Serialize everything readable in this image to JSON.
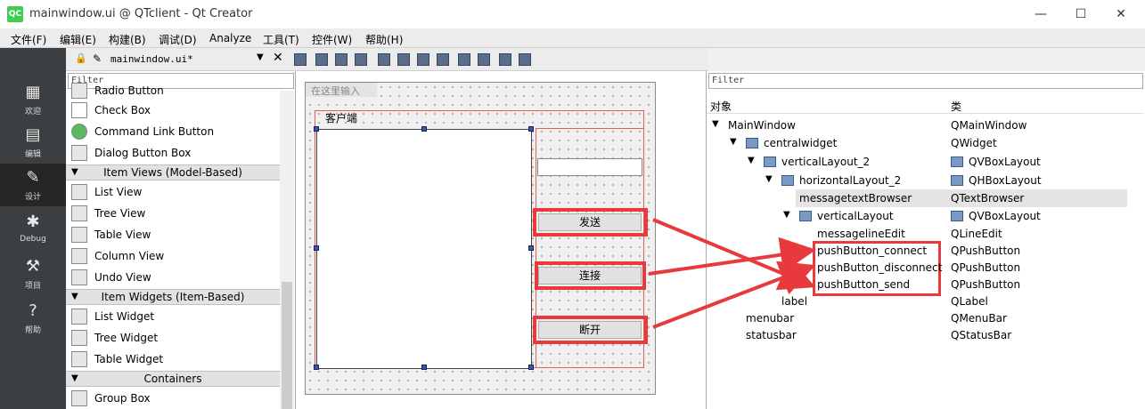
{
  "window": {
    "title": "mainwindow.ui @ QTclient - Qt Creator",
    "app_icon": "QC",
    "minimize": "—",
    "maximize": "☐",
    "close": "✕"
  },
  "menu": [
    "文件(F)",
    "编辑(E)",
    "构建(B)",
    "调试(D)",
    "Analyze",
    "工具(T)",
    "控件(W)",
    "帮助(H)"
  ],
  "modes": [
    {
      "label": "欢迎",
      "icon": "grid-icon"
    },
    {
      "label": "编辑",
      "icon": "document-icon"
    },
    {
      "label": "设计",
      "icon": "pencil-icon"
    },
    {
      "label": "Debug",
      "icon": "bug-icon"
    },
    {
      "label": "项目",
      "icon": "wrench-icon"
    },
    {
      "label": "帮助",
      "icon": "help-icon"
    }
  ],
  "editor": {
    "document": "mainwindow.ui*"
  },
  "widgetbox": {
    "filter_placeholder": "Filter",
    "items": [
      {
        "type": "item",
        "label": "Radio Button"
      },
      {
        "type": "item",
        "label": "Check Box"
      },
      {
        "type": "item",
        "label": "Command Link Button"
      },
      {
        "type": "item",
        "label": "Dialog Button Box"
      },
      {
        "type": "cat",
        "label": "Item Views (Model-Based)"
      },
      {
        "type": "item",
        "label": "List View"
      },
      {
        "type": "item",
        "label": "Tree View"
      },
      {
        "type": "item",
        "label": "Table View"
      },
      {
        "type": "item",
        "label": "Column View"
      },
      {
        "type": "item",
        "label": "Undo View"
      },
      {
        "type": "cat",
        "label": "Item Widgets (Item-Based)"
      },
      {
        "type": "item",
        "label": "List Widget"
      },
      {
        "type": "item",
        "label": "Tree Widget"
      },
      {
        "type": "item",
        "label": "Table Widget"
      },
      {
        "type": "cat",
        "label": "Containers"
      },
      {
        "type": "item",
        "label": "Group Box"
      }
    ]
  },
  "form": {
    "menu_placeholder": "在这里输入",
    "label": "客户端",
    "buttons": {
      "send": "发送",
      "connect": "连接",
      "disconnect": "断开"
    }
  },
  "inspector": {
    "filter_placeholder": "Filter",
    "header_object": "对象",
    "header_class": "类",
    "rows": [
      {
        "name": "MainWindow",
        "cls": "QMainWindow"
      },
      {
        "name": "centralwidget",
        "cls": "QWidget"
      },
      {
        "name": "verticalLayout_2",
        "cls": "QVBoxLayout"
      },
      {
        "name": "horizontalLayout_2",
        "cls": "QHBoxLayout"
      },
      {
        "name": "messagetextBrowser",
        "cls": "QTextBrowser"
      },
      {
        "name": "verticalLayout",
        "cls": "QVBoxLayout"
      },
      {
        "name": "messagelineEdit",
        "cls": "QLineEdit"
      },
      {
        "name": "pushButton_connect",
        "cls": "QPushButton"
      },
      {
        "name": "pushButton_disconnect",
        "cls": "QPushButton"
      },
      {
        "name": "pushButton_send",
        "cls": "QPushButton"
      },
      {
        "name": "label",
        "cls": "QLabel"
      },
      {
        "name": "menubar",
        "cls": "QMenuBar"
      },
      {
        "name": "statusbar",
        "cls": "QStatusBar"
      }
    ]
  },
  "annotation_color": "#e8393c"
}
